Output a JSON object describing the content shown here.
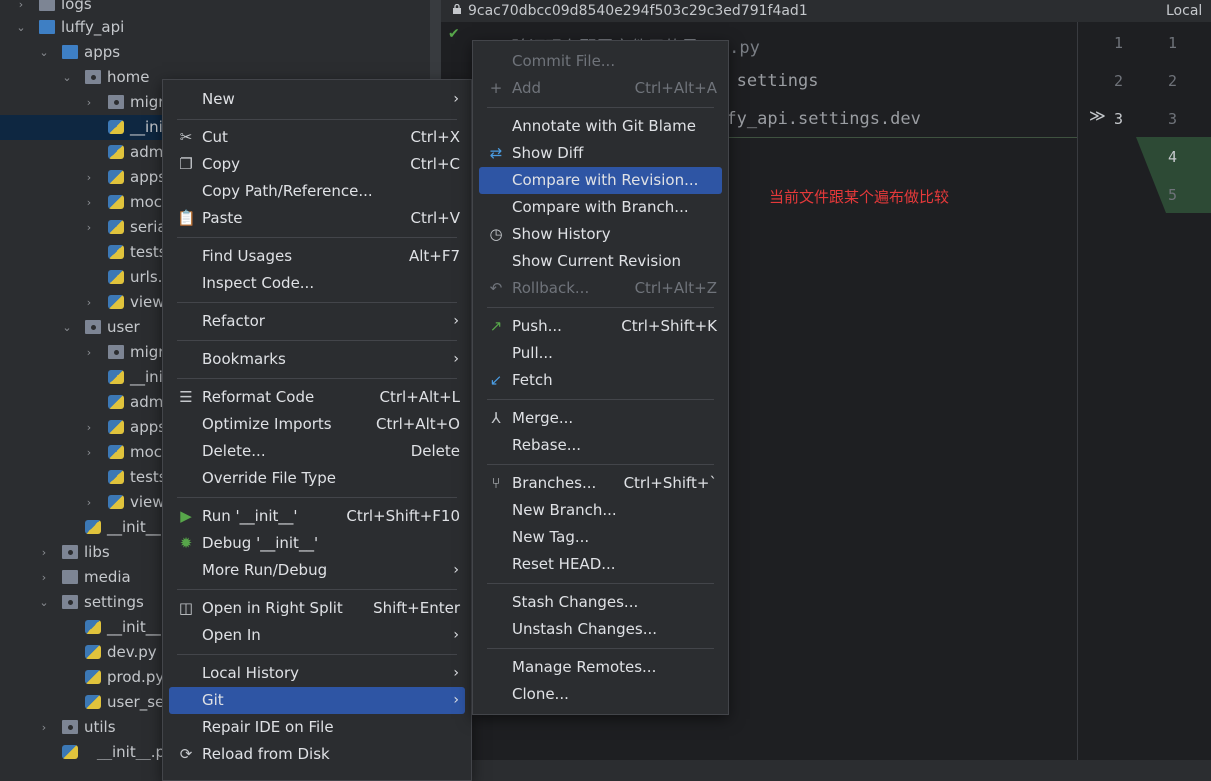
{
  "tree": {
    "items": [
      {
        "label": "logs",
        "chev": "›",
        "type": "folder"
      },
      {
        "label": "luffy_api",
        "chev": "⌄",
        "type": "folder-blue"
      },
      {
        "label": "apps",
        "chev": "⌄",
        "type": "folder-blue"
      },
      {
        "label": "home",
        "chev": "⌄",
        "type": "pkg"
      },
      {
        "label": "migr",
        "chev": "›",
        "type": "pkg"
      },
      {
        "label": "__ini",
        "chev": "",
        "type": "py"
      },
      {
        "label": "adm",
        "chev": "",
        "type": "py"
      },
      {
        "label": "apps",
        "chev": "›",
        "type": "py"
      },
      {
        "label": "moc",
        "chev": "›",
        "type": "py"
      },
      {
        "label": "seria",
        "chev": "›",
        "type": "py"
      },
      {
        "label": "tests",
        "chev": "",
        "type": "py"
      },
      {
        "label": "urls.",
        "chev": "",
        "type": "py"
      },
      {
        "label": "view",
        "chev": "›",
        "type": "py"
      },
      {
        "label": "user",
        "chev": "⌄",
        "type": "pkg"
      },
      {
        "label": "migr",
        "chev": "›",
        "type": "pkg"
      },
      {
        "label": "__ini",
        "chev": "",
        "type": "py"
      },
      {
        "label": "adm",
        "chev": "",
        "type": "py"
      },
      {
        "label": "apps",
        "chev": "›",
        "type": "py"
      },
      {
        "label": "moc",
        "chev": "›",
        "type": "py"
      },
      {
        "label": "tests",
        "chev": "",
        "type": "py"
      },
      {
        "label": "view",
        "chev": "›",
        "type": "py"
      },
      {
        "label": "__init__.",
        "chev": "",
        "type": "py"
      },
      {
        "label": "libs",
        "chev": "›",
        "type": "folder"
      },
      {
        "label": "media",
        "chev": "›",
        "type": "folder"
      },
      {
        "label": "settings",
        "chev": "⌄",
        "type": "folder"
      },
      {
        "label": "__init__.",
        "chev": "",
        "type": "py"
      },
      {
        "label": "dev.py",
        "chev": "",
        "type": "py"
      },
      {
        "label": "prod.py",
        "chev": "",
        "type": "py"
      },
      {
        "label": "user_se",
        "chev": "",
        "type": "py"
      },
      {
        "label": "utils",
        "chev": "›",
        "type": "folder"
      },
      {
        "label": "__init__.py",
        "chev": "",
        "type": "py"
      }
    ]
  },
  "editor": {
    "revision_hash": "9cac70dbcc09d8540e294f503c29c3ed791f4ad1",
    "local_label": "Local (",
    "code_lines": [
      "# 验证现在配置文件用的是dev.py",
      "                      t settings",
      "                      ffy_api.settings.dev"
    ],
    "left_line_numbers": [
      "1",
      "2",
      "3"
    ],
    "right_line_numbers": [
      "1",
      "2",
      "3",
      "4",
      "5"
    ],
    "annotation": "当前文件跟某个遍布做比较"
  },
  "context_menu": {
    "items": [
      {
        "label": "New",
        "shortcut": "",
        "submenu": true,
        "icon": ""
      },
      {
        "label": "Cut",
        "shortcut": "Ctrl+X",
        "submenu": false,
        "icon": "✂"
      },
      {
        "label": "Copy",
        "shortcut": "Ctrl+C",
        "submenu": false,
        "icon": "❐"
      },
      {
        "label": "Copy Path/Reference...",
        "shortcut": "",
        "submenu": false,
        "icon": ""
      },
      {
        "label": "Paste",
        "shortcut": "Ctrl+V",
        "submenu": false,
        "icon": "📋"
      },
      {
        "label": "Find Usages",
        "shortcut": "Alt+F7",
        "submenu": false,
        "icon": ""
      },
      {
        "label": "Inspect Code...",
        "shortcut": "",
        "submenu": false,
        "icon": ""
      },
      {
        "label": "Refactor",
        "shortcut": "",
        "submenu": true,
        "icon": ""
      },
      {
        "label": "Bookmarks",
        "shortcut": "",
        "submenu": true,
        "icon": ""
      },
      {
        "label": "Reformat Code",
        "shortcut": "Ctrl+Alt+L",
        "submenu": false,
        "icon": "☰"
      },
      {
        "label": "Optimize Imports",
        "shortcut": "Ctrl+Alt+O",
        "submenu": false,
        "icon": ""
      },
      {
        "label": "Delete...",
        "shortcut": "Delete",
        "submenu": false,
        "icon": ""
      },
      {
        "label": "Override File Type",
        "shortcut": "",
        "submenu": false,
        "icon": ""
      },
      {
        "label": "Run '__init__'",
        "shortcut": "Ctrl+Shift+F10",
        "submenu": false,
        "icon": "▶"
      },
      {
        "label": "Debug '__init__'",
        "shortcut": "",
        "submenu": false,
        "icon": "✹"
      },
      {
        "label": "More Run/Debug",
        "shortcut": "",
        "submenu": true,
        "icon": ""
      },
      {
        "label": "Open in Right Split",
        "shortcut": "Shift+Enter",
        "submenu": false,
        "icon": "◫"
      },
      {
        "label": "Open In",
        "shortcut": "",
        "submenu": true,
        "icon": ""
      },
      {
        "label": "Local History",
        "shortcut": "",
        "submenu": true,
        "icon": ""
      },
      {
        "label": "Git",
        "shortcut": "",
        "submenu": true,
        "icon": ""
      },
      {
        "label": "Repair IDE on File",
        "shortcut": "",
        "submenu": false,
        "icon": ""
      },
      {
        "label": "Reload from Disk",
        "shortcut": "",
        "submenu": false,
        "icon": "⟳"
      }
    ]
  },
  "git_menu": {
    "items": [
      {
        "label": "Commit File...",
        "shortcut": "",
        "icon": ""
      },
      {
        "label": "Add",
        "shortcut": "Ctrl+Alt+A",
        "icon": "+"
      },
      {
        "label": "Annotate with Git Blame",
        "shortcut": "",
        "icon": ""
      },
      {
        "label": "Show Diff",
        "shortcut": "",
        "icon": "⇄"
      },
      {
        "label": "Compare with Revision...",
        "shortcut": "",
        "icon": ""
      },
      {
        "label": "Compare with Branch...",
        "shortcut": "",
        "icon": ""
      },
      {
        "label": "Show History",
        "shortcut": "",
        "icon": "◷"
      },
      {
        "label": "Show Current Revision",
        "shortcut": "",
        "icon": ""
      },
      {
        "label": "Rollback...",
        "shortcut": "Ctrl+Alt+Z",
        "icon": "↶"
      },
      {
        "label": "Push...",
        "shortcut": "Ctrl+Shift+K",
        "icon": "↗"
      },
      {
        "label": "Pull...",
        "shortcut": "",
        "icon": ""
      },
      {
        "label": "Fetch",
        "shortcut": "",
        "icon": "↙"
      },
      {
        "label": "Merge...",
        "shortcut": "",
        "icon": "⅄"
      },
      {
        "label": "Rebase...",
        "shortcut": "",
        "icon": ""
      },
      {
        "label": "Branches...",
        "shortcut": "Ctrl+Shift+`",
        "icon": "⑂"
      },
      {
        "label": "New Branch...",
        "shortcut": "",
        "icon": ""
      },
      {
        "label": "New Tag...",
        "shortcut": "",
        "icon": ""
      },
      {
        "label": "Reset HEAD...",
        "shortcut": "",
        "icon": ""
      },
      {
        "label": "Stash Changes...",
        "shortcut": "",
        "icon": ""
      },
      {
        "label": "Unstash Changes...",
        "shortcut": "",
        "icon": ""
      },
      {
        "label": "Manage Remotes...",
        "shortcut": "",
        "icon": ""
      },
      {
        "label": "Clone...",
        "shortcut": "",
        "icon": ""
      }
    ]
  },
  "colors": {
    "highlight": "#2e55a4",
    "selection_row": "#0e2741",
    "annotation": "#e5393a",
    "diff_added": "#2d4a35"
  }
}
